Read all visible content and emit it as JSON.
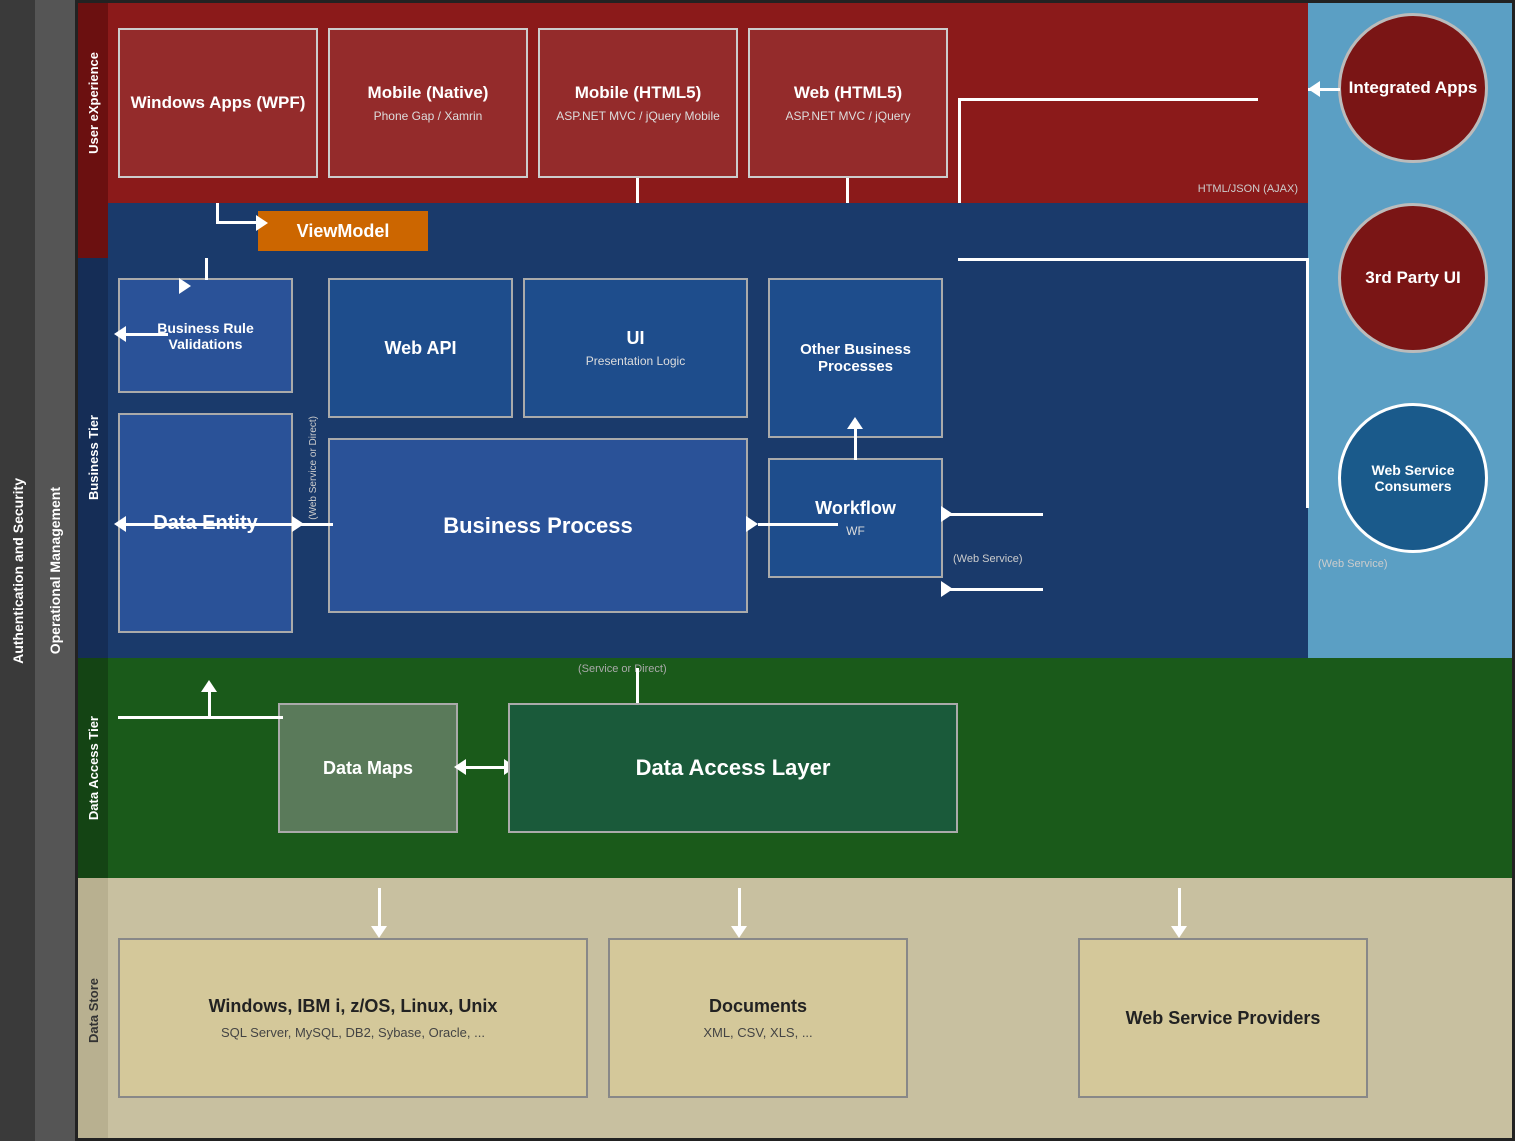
{
  "leftLabels": {
    "auth": "Authentication and Security",
    "ops": "Operational Management"
  },
  "tiers": {
    "ux": {
      "label": "User eXperience",
      "boxes": [
        {
          "title": "Windows Apps (WPF)",
          "subtitle": ""
        },
        {
          "title": "Mobile (Native)",
          "subtitle": "Phone Gap / Xamrin"
        },
        {
          "title": "Mobile (HTML5)",
          "subtitle": "ASP.NET MVC / jQuery Mobile"
        },
        {
          "title": "Web (HTML5)",
          "subtitle": "ASP.NET MVC / jQuery"
        }
      ]
    },
    "viewmodel": {
      "label": "ViewModel"
    },
    "business": {
      "label": "Business Tier",
      "businessRuleLabel": "Business Rule Validations",
      "dataEntityLabel": "Data Entity",
      "webApiLabel": "Web API",
      "uiLabel": "UI",
      "uiSub": "Presentation Logic",
      "businessProcessLabel": "Business Process",
      "otherBPLabel": "Other Business Processes",
      "workflowLabel": "Workflow",
      "workflowSub": "WF",
      "webServiceDirectLabel": "(Web Service or Direct)",
      "webServiceLabel": "(Web Service)"
    },
    "dataAccess": {
      "label": "Data Access Tier",
      "dataMapsLabel": "Data Maps",
      "dalLabel": "Data Access Layer",
      "serviceDirectLabel": "(Service or Direct)"
    },
    "dataStore": {
      "label": "Data Store",
      "dbTitle": "Windows, IBM i, z/OS, Linux, Unix",
      "dbSub": "SQL Server, MySQL, DB2, Sybase, Oracle, ...",
      "docsTitle": "Documents",
      "docsSub": "XML, CSV, XLS, ...",
      "wsProvidersTitle": "Web Service Providers"
    }
  },
  "rightPanel": {
    "integratedApps": "Integrated Apps",
    "thirdPartyUI": "3rd Party UI",
    "wsConsumers": "Web Service Consumers",
    "htmlJsonLabel": "HTML/JSON (AJAX)",
    "wsServiceLabel": "(Web Service)"
  },
  "colors": {
    "uxBg": "#8b1a1a",
    "businessBg": "#1a3a6b",
    "dataAccessBg": "#1a5a1a",
    "dataStoreBg": "#c8c0a0",
    "rightPanelBg": "#5b9fc4",
    "integratedCircle": "#7a1515",
    "thirdPartyCircle": "#7a1515",
    "wsConsumersCircle": "#1a5a8b",
    "viewmodelOrange": "#cc6600",
    "white": "#ffffff"
  }
}
